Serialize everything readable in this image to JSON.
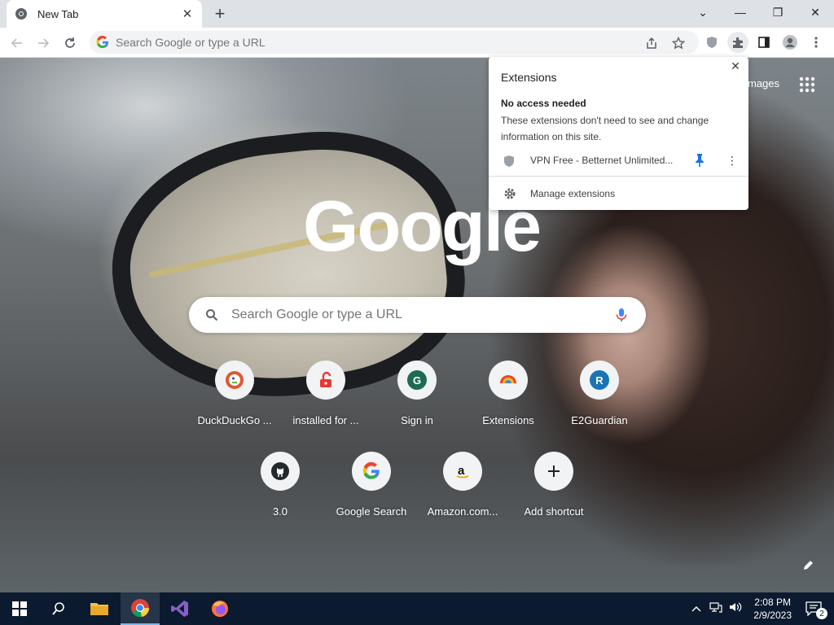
{
  "window": {
    "tab_title": "New Tab",
    "tab_close": "✕",
    "new_tab": "+",
    "controls": {
      "dropdown": "⌄",
      "minimize": "—",
      "restore": "❐",
      "close": "✕"
    }
  },
  "toolbar": {
    "omnibox_placeholder": "Search Google or type a URL"
  },
  "ntp": {
    "logo": "Google",
    "search_placeholder": "Search Google or type a URL",
    "images_label": "mages",
    "shortcuts": [
      {
        "label": "DuckDuckGo ...",
        "icon": "duckduckgo-icon"
      },
      {
        "label": "installed for ...",
        "icon": "unlock-icon"
      },
      {
        "label": "Sign in",
        "icon": "letter-g-avatar"
      },
      {
        "label": "Extensions",
        "icon": "chrome-icon"
      },
      {
        "label": "E2Guardian",
        "icon": "letter-r-avatar"
      },
      {
        "label": "3.0",
        "icon": "github-icon"
      },
      {
        "label": "Google Search",
        "icon": "google-icon"
      },
      {
        "label": "Amazon.com...",
        "icon": "amazon-icon"
      },
      {
        "label": "Add shortcut",
        "icon": "plus-icon"
      }
    ],
    "avatar_letters": {
      "sign_in": "G",
      "e2guardian": "R"
    }
  },
  "extensions_popup": {
    "title": "Extensions",
    "close": "✕",
    "section_title": "No access needed",
    "section_desc": "These extensions don't need to see and change information on this site.",
    "extension_name": "VPN Free - Betternet Unlimited...",
    "more": "⋮",
    "manage_label": "Manage extensions"
  },
  "taskbar": {
    "time": "2:08 PM",
    "date": "2/9/2023",
    "notification_count": "2"
  },
  "colors": {
    "accent_blue": "#1a73e8",
    "taskbar_bg": "#0b1a2e"
  }
}
